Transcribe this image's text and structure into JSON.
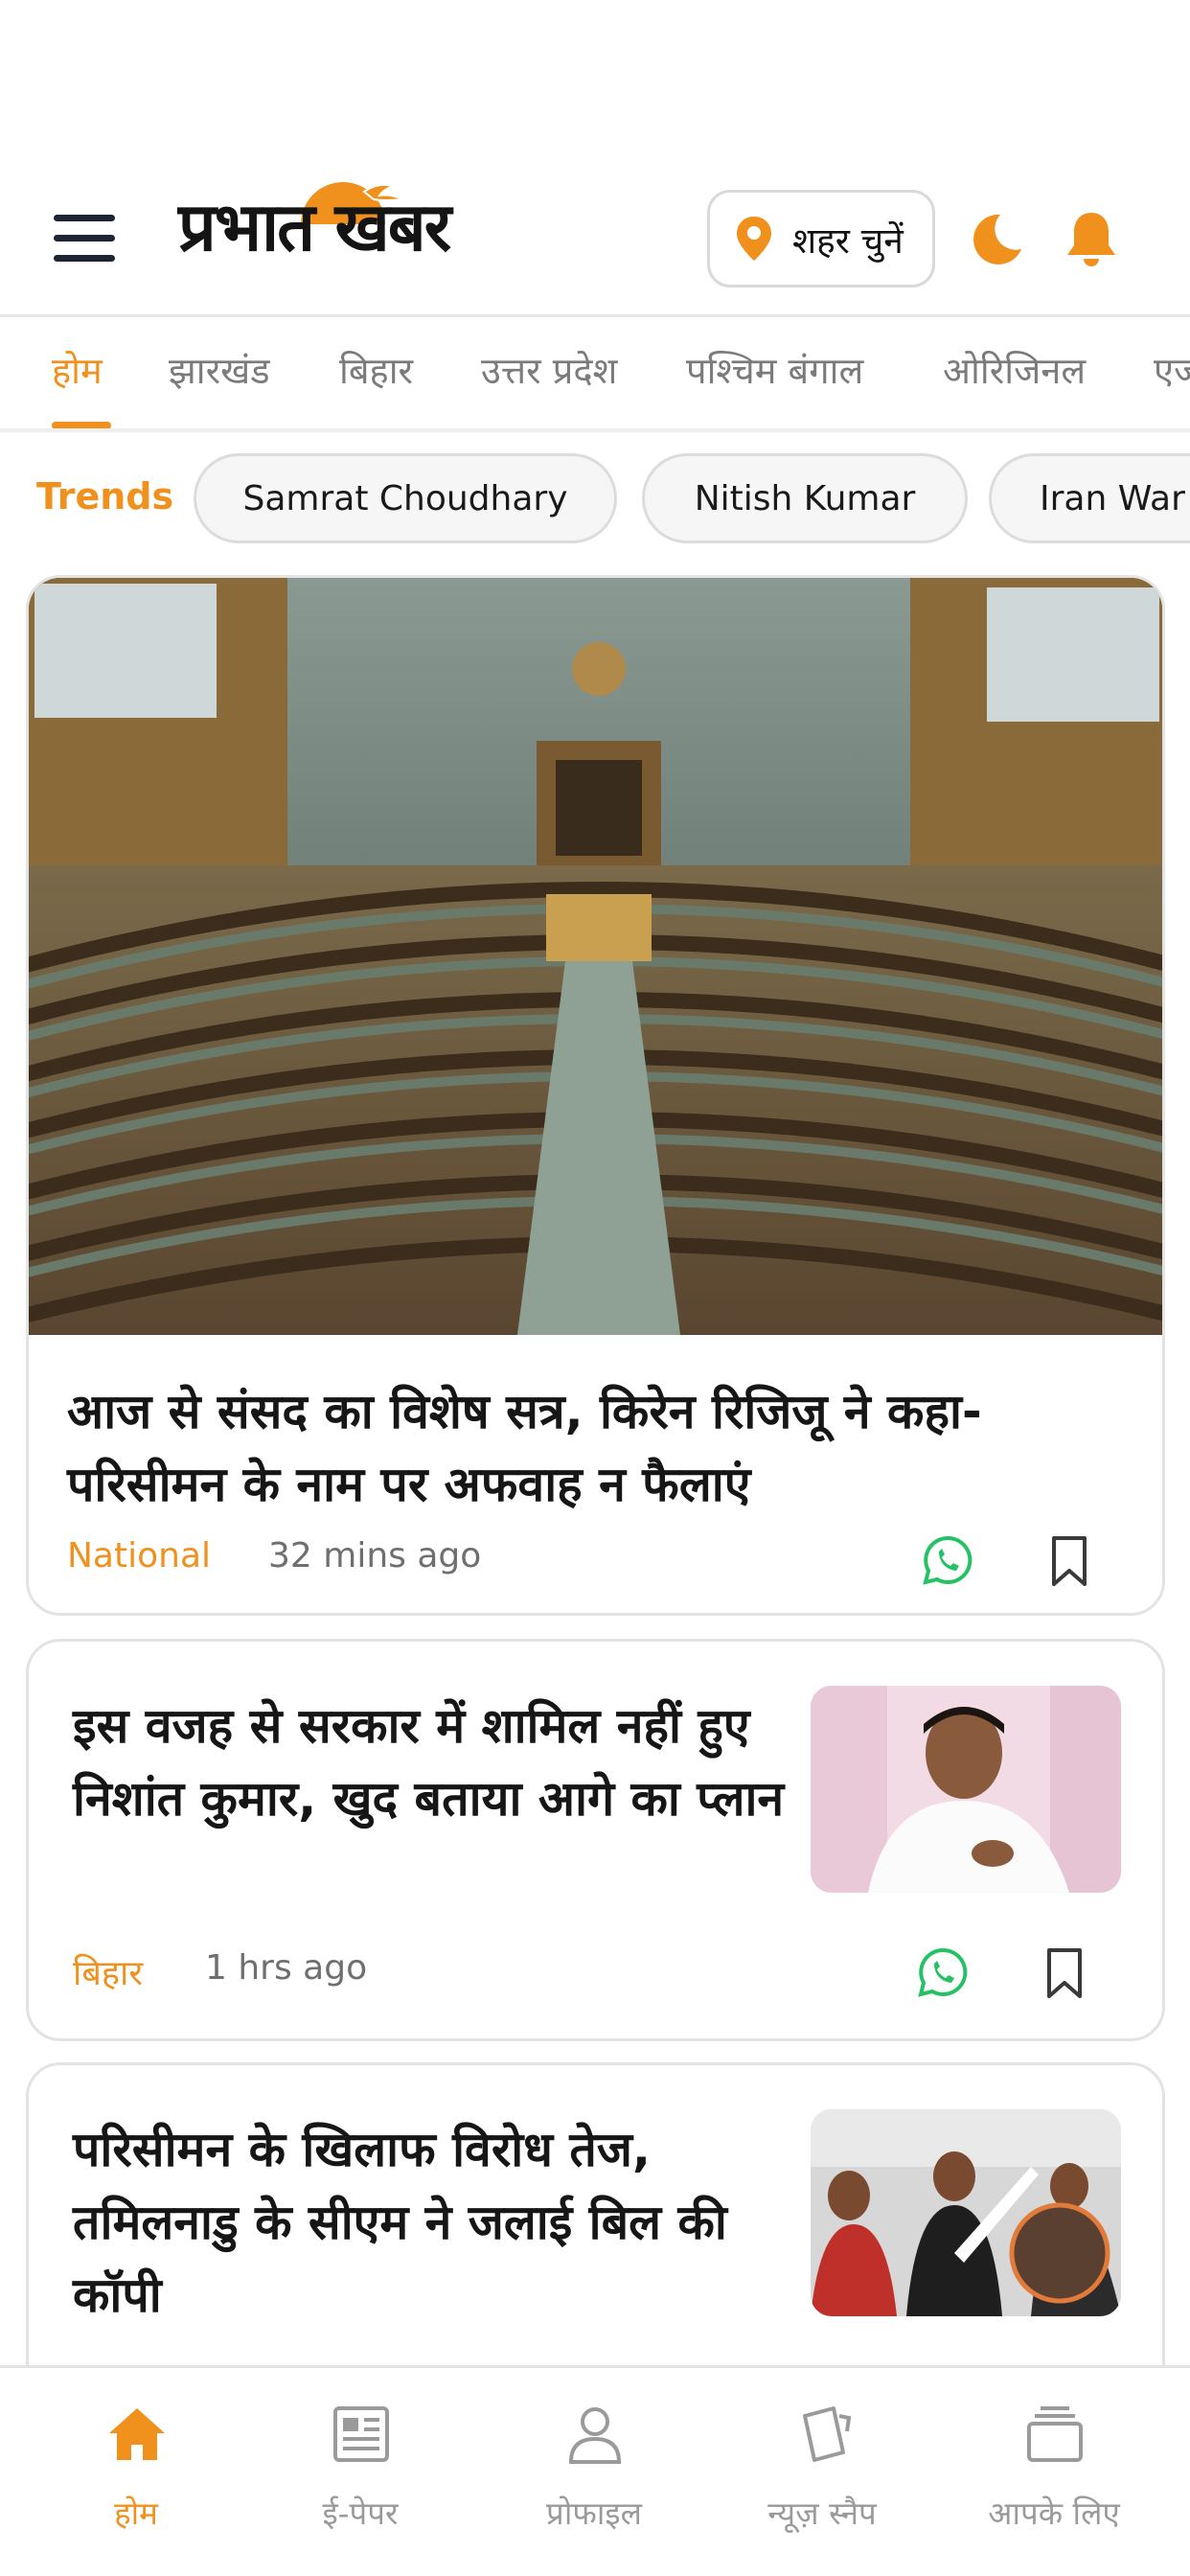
{
  "header": {
    "logo_text": "प्रभात खबर",
    "city_button_label": "शहर चुनें"
  },
  "nav_tabs": [
    {
      "label": "होम",
      "active": true
    },
    {
      "label": "झारखंड",
      "active": false
    },
    {
      "label": "बिहार",
      "active": false
    },
    {
      "label": "उत्तर प्रदेश",
      "active": false
    },
    {
      "label": "पश्चिम बंगाल",
      "active": false
    },
    {
      "label": "ओरिजिनल",
      "active": false
    },
    {
      "label": "एज",
      "active": false
    }
  ],
  "trends": {
    "label": "Trends",
    "chips": [
      "Samrat Choudhary",
      "Nitish Kumar",
      "Iran War"
    ]
  },
  "articles": [
    {
      "headline": "आज से संसद का विशेष सत्र, किरेन रिजिजू ने कहा- परिसीमन के नाम पर अफवाह न फैलाएं",
      "category": "National",
      "time": "32 mins ago"
    },
    {
      "headline": "इस वजह से सरकार में शामिल नहीं हुए निशांत कुमार, खुद बताया आगे का प्लान",
      "category": "बिहार",
      "time": "1 hrs ago"
    },
    {
      "headline": "परिसीमन के खिलाफ विरोध तेज, तमिलनाडु के सीएम ने जलाई बिल की कॉपी"
    }
  ],
  "bottom_nav": [
    {
      "label": "होम",
      "icon": "home-icon",
      "active": true
    },
    {
      "label": "ई-पेपर",
      "icon": "newspaper-icon",
      "active": false
    },
    {
      "label": "प्रोफाइल",
      "icon": "profile-icon",
      "active": false
    },
    {
      "label": "न्यूज़ स्नैप",
      "icon": "cards-icon",
      "active": false
    },
    {
      "label": "आपके लिए",
      "icon": "stack-icon",
      "active": false
    }
  ],
  "colors": {
    "accent": "#f0901d",
    "whatsapp": "#25c265",
    "text_dark": "#161616",
    "text_muted": "#6f6f6f"
  }
}
